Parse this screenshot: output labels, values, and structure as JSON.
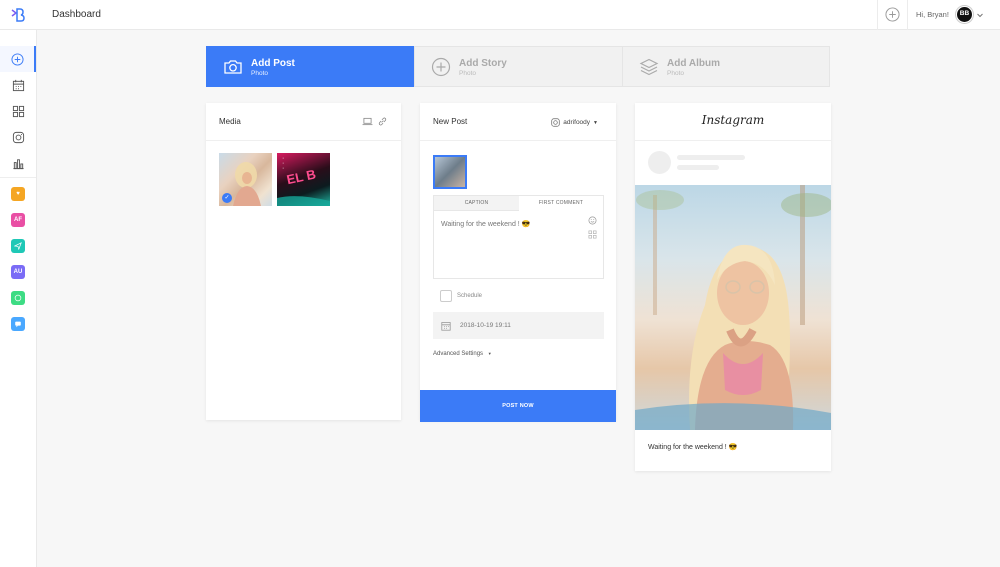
{
  "topbar": {
    "title": "Dashboard",
    "greeting": "Hi, Bryan!",
    "avatar_initials": "BB"
  },
  "sidebar": {
    "items": [
      {
        "name": "add",
        "icon": "plus-circle-icon",
        "active": true
      },
      {
        "name": "calendar",
        "icon": "calendar-icon"
      },
      {
        "name": "grid",
        "icon": "grid-icon"
      },
      {
        "name": "instagram",
        "icon": "instagram-icon"
      },
      {
        "name": "analytics",
        "icon": "bar-chart-icon"
      }
    ],
    "apps": [
      {
        "label": "",
        "color": "#f5a623",
        "icon": "heart-icon"
      },
      {
        "label": "AF",
        "color": "#e94fa4"
      },
      {
        "label": "",
        "color": "#1fc8b6",
        "icon": "send-icon"
      },
      {
        "label": "AU",
        "color": "#7b6cf6"
      },
      {
        "label": "",
        "color": "#3ddc84",
        "icon": "chat-bubble-icon"
      },
      {
        "label": "",
        "color": "#4aa8ff",
        "icon": "message-icon"
      }
    ]
  },
  "tabs": [
    {
      "label": "Add Post",
      "sub": "Photo"
    },
    {
      "label": "Add Story",
      "sub": "Photo"
    },
    {
      "label": "Add Album",
      "sub": "Photo"
    }
  ],
  "media": {
    "title": "Media"
  },
  "new_post": {
    "title": "New Post",
    "account": "adrifoody",
    "tabs": {
      "caption": "CAPTION",
      "first_comment": "FIRST COMMENT"
    },
    "caption_text": "Waiting for the weekend ! 😎",
    "schedule_label": "Schedule",
    "date_value": "2018-10-19 19:11",
    "advanced_settings": "Advanced Settings",
    "post_button": "POST NOW"
  },
  "preview": {
    "logo": "Instagram",
    "caption": "Waiting for the weekend ! 😎"
  },
  "colors": {
    "accent": "#3b7bf7"
  }
}
